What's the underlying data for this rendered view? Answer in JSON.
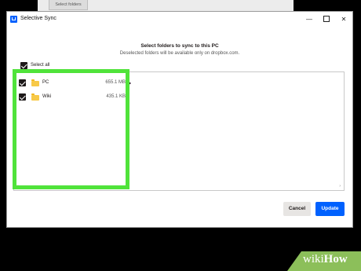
{
  "background_window": {
    "tab_label": "Select folders"
  },
  "dialog": {
    "title": "Selective Sync",
    "window_buttons": {
      "minimize": "—",
      "close": "✕"
    },
    "heading": "Select folders to sync to this PC",
    "subheading": "Deselected folders will be available only on dropbox.com.",
    "select_all": {
      "label": "Select all",
      "checked": true
    },
    "folders": [
      {
        "name": "PC",
        "size": "655.1 MB",
        "checked": true,
        "expandable": true
      },
      {
        "name": "Wiki",
        "size": "435.1 KB",
        "checked": true,
        "expandable": false
      }
    ],
    "scroll_left": "‹",
    "scroll_right": "›",
    "cancel_label": "Cancel",
    "update_label": "Update"
  },
  "colors": {
    "primary": "#0061fe",
    "highlight": "#50e33a",
    "folder": "#f7c948",
    "watermark": "#8cbf5a"
  },
  "watermark": {
    "text_light": "wiki",
    "text_bold": "How"
  }
}
